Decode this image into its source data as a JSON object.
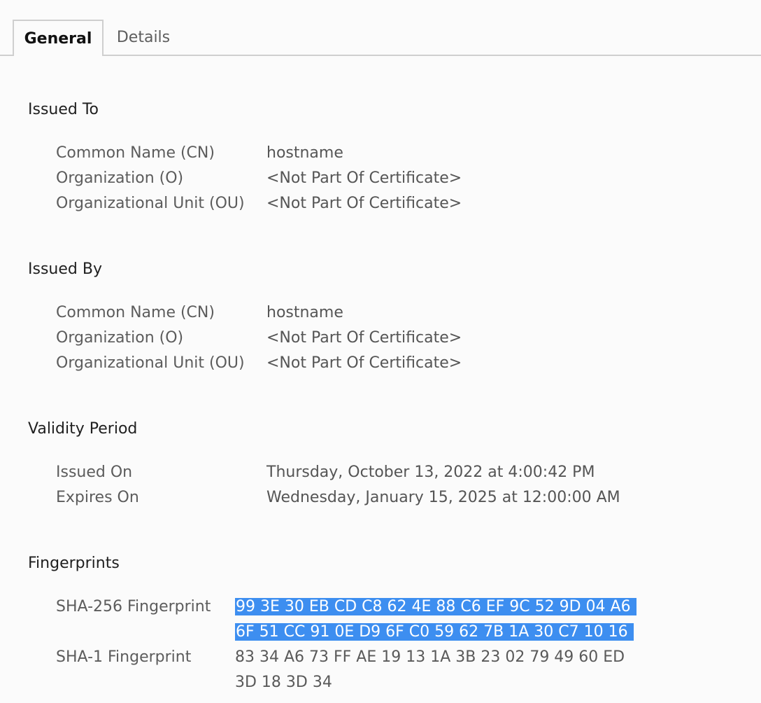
{
  "tabs": [
    {
      "label": "General",
      "active": true
    },
    {
      "label": "Details",
      "active": false
    }
  ],
  "issued_to": {
    "title": "Issued To",
    "rows": [
      {
        "label": "Common Name (CN)",
        "value": "hostname"
      },
      {
        "label": "Organization (O)",
        "value": "<Not Part Of Certificate>"
      },
      {
        "label": "Organizational Unit (OU)",
        "value": "<Not Part Of Certificate>"
      }
    ]
  },
  "issued_by": {
    "title": "Issued By",
    "rows": [
      {
        "label": "Common Name (CN)",
        "value": "hostname"
      },
      {
        "label": "Organization (O)",
        "value": "<Not Part Of Certificate>"
      },
      {
        "label": "Organizational Unit (OU)",
        "value": "<Not Part Of Certificate>"
      }
    ]
  },
  "validity": {
    "title": "Validity Period",
    "rows": [
      {
        "label": "Issued On",
        "value": "Thursday, October 13, 2022 at 4:00:42 PM"
      },
      {
        "label": "Expires On",
        "value": "Wednesday, January 15, 2025 at 12:00:00 AM"
      }
    ]
  },
  "fingerprints": {
    "title": "Fingerprints",
    "sha256": {
      "label": "SHA-256 Fingerprint",
      "lines": [
        "99 3E 30 EB CD C8 62 4E 88 C6 EF 9C 52 9D 04 A6",
        "6F 51 CC 91 0E D9 6F C0 59 62 7B 1A 30 C7 10 16"
      ],
      "selected": true
    },
    "sha1": {
      "label": "SHA-1 Fingerprint",
      "lines": [
        "83 34 A6 73 FF AE 19 13 1A 3B 23 02 79 49 60 ED",
        "3D 18 3D 34"
      ],
      "selected": false
    }
  },
  "colors": {
    "selection": "#3d8ef0",
    "tab_border": "#cfcfcf"
  }
}
